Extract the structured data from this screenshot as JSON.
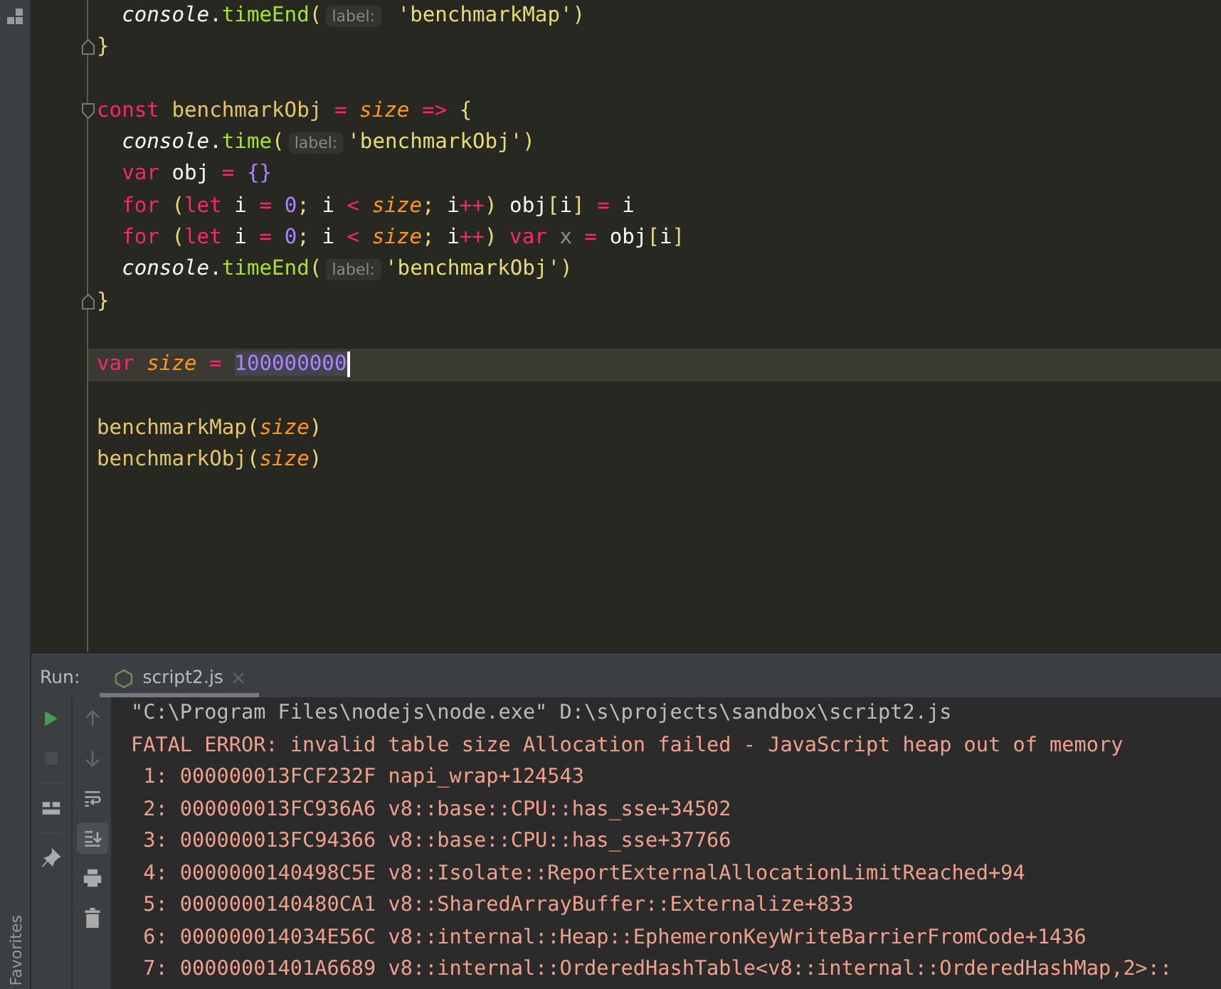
{
  "editor": {
    "lines": [
      {
        "current": false,
        "fold_start": false,
        "fold_end": false,
        "tokens": [
          {
            "text": "  console",
            "kind": "object"
          },
          {
            "text": ".",
            "kind": "plain"
          },
          {
            "text": "timeEnd",
            "kind": "method"
          },
          {
            "text": "(",
            "kind": "paren"
          },
          {
            "text": "label:",
            "kind": "hint"
          },
          {
            "text": " 'benchmarkMap'",
            "kind": "string"
          },
          {
            "text": ")",
            "kind": "paren"
          }
        ]
      },
      {
        "current": false,
        "fold_start": false,
        "fold_end": true,
        "tokens": [
          {
            "text": "}",
            "kind": "paren"
          }
        ]
      },
      {
        "current": false,
        "fold_start": false,
        "fold_end": false
      },
      {
        "current": false,
        "fold_start": true,
        "fold_end": false,
        "tokens": [
          {
            "text": "const",
            "kind": "keyword"
          },
          {
            "text": " benchmarkObj",
            "kind": "function"
          },
          {
            "text": " = ",
            "kind": "operator"
          },
          {
            "text": "size",
            "kind": "param"
          },
          {
            "text": " => ",
            "kind": "operator"
          },
          {
            "text": "{",
            "kind": "paren"
          }
        ]
      },
      {
        "current": false,
        "fold_start": false,
        "fold_end": false,
        "tokens": [
          {
            "text": "  console",
            "kind": "object"
          },
          {
            "text": ".",
            "kind": "plain"
          },
          {
            "text": "time",
            "kind": "method"
          },
          {
            "text": "(",
            "kind": "paren"
          },
          {
            "text": "label:",
            "kind": "hint"
          },
          {
            "text": "'benchmarkObj'",
            "kind": "string"
          },
          {
            "text": ")",
            "kind": "paren"
          }
        ]
      },
      {
        "current": false,
        "fold_start": false,
        "fold_end": false,
        "tokens": [
          {
            "text": "  var",
            "kind": "keyword"
          },
          {
            "text": " obj ",
            "kind": "plain"
          },
          {
            "text": "= ",
            "kind": "operator"
          },
          {
            "text": "{}",
            "kind": "brace"
          }
        ]
      },
      {
        "current": false,
        "fold_start": false,
        "fold_end": false,
        "tokens": [
          {
            "text": "  for",
            "kind": "keyword"
          },
          {
            "text": " (",
            "kind": "paren"
          },
          {
            "text": "let",
            "kind": "keyword"
          },
          {
            "text": " i ",
            "kind": "plain"
          },
          {
            "text": "= ",
            "kind": "operator"
          },
          {
            "text": "0",
            "kind": "number"
          },
          {
            "text": ";",
            "kind": "paren"
          },
          {
            "text": " i ",
            "kind": "plain"
          },
          {
            "text": "< ",
            "kind": "operator"
          },
          {
            "text": "size",
            "kind": "param"
          },
          {
            "text": ";",
            "kind": "paren"
          },
          {
            "text": " i",
            "kind": "plain"
          },
          {
            "text": "++",
            "kind": "operator"
          },
          {
            "text": ")",
            "kind": "paren"
          },
          {
            "text": " obj",
            "kind": "plain"
          },
          {
            "text": "[",
            "kind": "paren"
          },
          {
            "text": "i",
            "kind": "plain"
          },
          {
            "text": "]",
            "kind": "paren"
          },
          {
            "text": " = ",
            "kind": "operator"
          },
          {
            "text": "i",
            "kind": "plain"
          }
        ]
      },
      {
        "current": false,
        "fold_start": false,
        "fold_end": false,
        "tokens": [
          {
            "text": "  for",
            "kind": "keyword"
          },
          {
            "text": " (",
            "kind": "paren"
          },
          {
            "text": "let",
            "kind": "keyword"
          },
          {
            "text": " i ",
            "kind": "plain"
          },
          {
            "text": "= ",
            "kind": "operator"
          },
          {
            "text": "0",
            "kind": "number"
          },
          {
            "text": ";",
            "kind": "paren"
          },
          {
            "text": " i ",
            "kind": "plain"
          },
          {
            "text": "< ",
            "kind": "operator"
          },
          {
            "text": "size",
            "kind": "param"
          },
          {
            "text": ";",
            "kind": "paren"
          },
          {
            "text": " i",
            "kind": "plain"
          },
          {
            "text": "++",
            "kind": "operator"
          },
          {
            "text": ")",
            "kind": "paren"
          },
          {
            "text": " var",
            "kind": "keyword"
          },
          {
            "text": " x",
            "kind": "unused"
          },
          {
            "text": " = ",
            "kind": "operator"
          },
          {
            "text": "obj",
            "kind": "plain"
          },
          {
            "text": "[",
            "kind": "paren"
          },
          {
            "text": "i",
            "kind": "plain"
          },
          {
            "text": "]",
            "kind": "paren"
          }
        ]
      },
      {
        "current": false,
        "fold_start": false,
        "fold_end": false,
        "tokens": [
          {
            "text": "  console",
            "kind": "object"
          },
          {
            "text": ".",
            "kind": "plain"
          },
          {
            "text": "timeEnd",
            "kind": "method"
          },
          {
            "text": "(",
            "kind": "paren"
          },
          {
            "text": "label:",
            "kind": "hint"
          },
          {
            "text": "'benchmarkObj'",
            "kind": "string"
          },
          {
            "text": ")",
            "kind": "paren"
          }
        ]
      },
      {
        "current": false,
        "fold_start": false,
        "fold_end": true,
        "tokens": [
          {
            "text": "}",
            "kind": "paren"
          }
        ]
      },
      {
        "current": false,
        "fold_start": false,
        "fold_end": false
      },
      {
        "current": true,
        "fold_start": false,
        "fold_end": false,
        "tokens": [
          {
            "text": "var",
            "kind": "keyword"
          },
          {
            "text": " size",
            "kind": "param"
          },
          {
            "text": " = ",
            "kind": "operator"
          },
          {
            "text": "100000000",
            "kind": "number_marked"
          }
        ]
      },
      {
        "current": false,
        "fold_start": false,
        "fold_end": false
      },
      {
        "current": false,
        "fold_start": false,
        "fold_end": false,
        "tokens": [
          {
            "text": "benchmarkMap",
            "kind": "function"
          },
          {
            "text": "(",
            "kind": "paren"
          },
          {
            "text": "size",
            "kind": "param"
          },
          {
            "text": ")",
            "kind": "paren"
          }
        ]
      },
      {
        "current": false,
        "fold_start": false,
        "fold_end": false,
        "tokens": [
          {
            "text": "benchmarkObj",
            "kind": "function"
          },
          {
            "text": "(",
            "kind": "paren"
          },
          {
            "text": "size",
            "kind": "param"
          },
          {
            "text": ")",
            "kind": "paren"
          }
        ]
      }
    ]
  },
  "side_bar": {
    "bottom_label": "Favorites"
  },
  "run_panel": {
    "label": "Run:",
    "tabs": [
      {
        "label": "script2.js",
        "selected": true
      }
    ],
    "toolbar_left": [
      {
        "kind": "run",
        "disabled": false
      },
      {
        "kind": "stop",
        "disabled": true
      },
      {
        "kind": "layout",
        "disabled": false
      },
      {
        "kind": "pin",
        "disabled": false
      }
    ],
    "toolbar_right": [
      {
        "kind": "up",
        "disabled": true,
        "selected": false
      },
      {
        "kind": "down",
        "disabled": true,
        "selected": false
      },
      {
        "kind": "wrap",
        "disabled": false,
        "selected": false
      },
      {
        "kind": "scroll_end",
        "disabled": false,
        "selected": true
      },
      {
        "kind": "print",
        "disabled": false,
        "selected": false
      },
      {
        "kind": "trash",
        "disabled": false,
        "selected": false
      }
    ],
    "console": [
      {
        "kind": "command",
        "text": "\"C:\\Program Files\\nodejs\\node.exe\" D:\\s\\projects\\sandbox\\script2.js"
      },
      {
        "kind": "error",
        "text": "FATAL ERROR: invalid table size Allocation failed - JavaScript heap out of memory"
      },
      {
        "kind": "error",
        "text": " 1: 000000013FCF232F napi_wrap+124543"
      },
      {
        "kind": "error",
        "text": " 2: 000000013FC936A6 v8::base::CPU::has_sse+34502"
      },
      {
        "kind": "error",
        "text": " 3: 000000013FC94366 v8::base::CPU::has_sse+37766"
      },
      {
        "kind": "error",
        "text": " 4: 0000000140498C5E v8::Isolate::ReportExternalAllocationLimitReached+94"
      },
      {
        "kind": "error",
        "text": " 5: 0000000140480CA1 v8::SharedArrayBuffer::Externalize+833"
      },
      {
        "kind": "error",
        "text": " 6: 000000014034E56C v8::internal::Heap::EphemeronKeyWriteBarrierFromCode+1436"
      },
      {
        "kind": "error",
        "text": " 7: 00000001401A6689 v8::internal::OrderedHashTable<v8::internal::OrderedHashMap,2>::"
      }
    ]
  }
}
